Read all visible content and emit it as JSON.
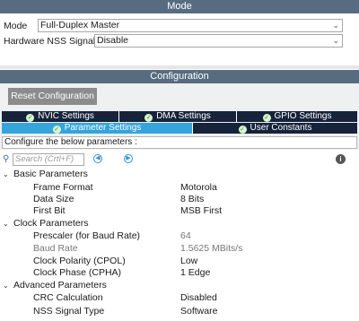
{
  "mode": {
    "header": "Mode",
    "mode_label": "Mode",
    "mode_value": "Full-Duplex Master",
    "nss_label": "Hardware NSS Signal",
    "nss_value": "Disable"
  },
  "configuration": {
    "header": "Configuration",
    "reset_button": "Reset Configuration",
    "tabs_row1": [
      "NVIC Settings",
      "DMA Settings",
      "GPIO Settings"
    ],
    "tabs_row2": [
      "Parameter Settings",
      "User Constants"
    ],
    "active_tab": "Parameter Settings",
    "description": "Configure the below parameters :",
    "search_placeholder": "Search (Crtl+F)",
    "icons": {
      "search": "search-icon",
      "prev": "chevron-left-icon",
      "next": "chevron-right-icon",
      "info": "info-icon",
      "check": "check-icon"
    }
  },
  "tree": {
    "groups": [
      {
        "label": "Basic Parameters",
        "params": [
          {
            "name": "Frame Format",
            "value": "Motorola"
          },
          {
            "name": "Data Size",
            "value": "8 Bits"
          },
          {
            "name": "First Bit",
            "value": "MSB First"
          }
        ]
      },
      {
        "label": "Clock Parameters",
        "params": [
          {
            "name": "Prescaler (for Baud Rate)",
            "value": "64"
          },
          {
            "name": "Baud Rate",
            "value": "1.5625 MBits/s"
          },
          {
            "name": "Clock Polarity (CPOL)",
            "value": "Low"
          },
          {
            "name": "Clock Phase (CPHA)",
            "value": "1 Edge"
          }
        ]
      },
      {
        "label": "Advanced Parameters",
        "params": [
          {
            "name": "CRC Calculation",
            "value": "Disabled"
          },
          {
            "name": "NSS Signal Type",
            "value": "Software"
          }
        ]
      }
    ]
  },
  "colors": {
    "section_bar": "#576c80",
    "tab_dark": "#16233b",
    "tab_active": "#35a4dc",
    "reset_button": "#8c8c8c"
  }
}
